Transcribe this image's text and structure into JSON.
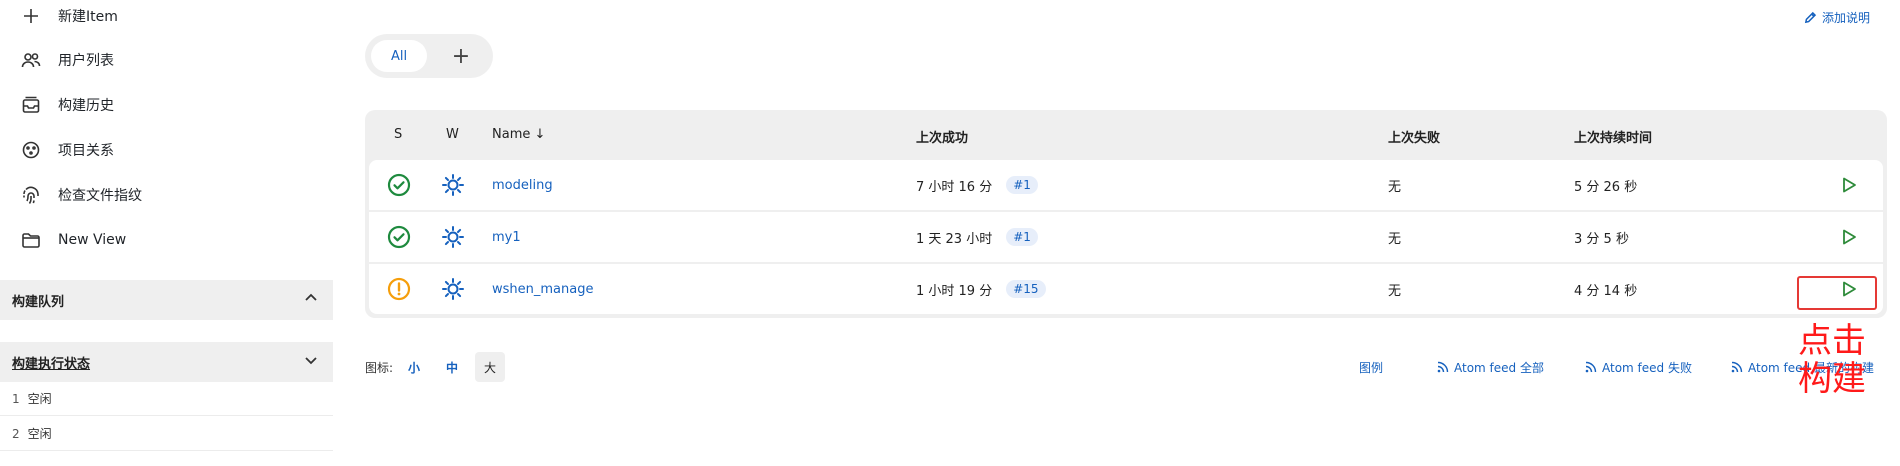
{
  "sidebar": {
    "items": [
      {
        "label": "新建Item",
        "icon": "plus-icon"
      },
      {
        "label": "用户列表",
        "icon": "users-icon"
      },
      {
        "label": "构建历史",
        "icon": "history-icon"
      },
      {
        "label": "项目关系",
        "icon": "relationship-icon"
      },
      {
        "label": "检查文件指纹",
        "icon": "fingerprint-icon"
      },
      {
        "label": "New View",
        "icon": "folder-icon"
      }
    ],
    "queue_panel": {
      "title": "构建队列"
    },
    "executor_panel": {
      "title": "构建执行状态",
      "executors": [
        {
          "number": "1",
          "status": "空闲"
        },
        {
          "number": "2",
          "status": "空闲"
        }
      ]
    }
  },
  "header": {
    "add_description": "添加说明"
  },
  "tabs": {
    "all_label": "All",
    "add_label": "+"
  },
  "table": {
    "headers": {
      "s": "S",
      "w": "W",
      "name": "Name ↓",
      "last_success": "上次成功",
      "last_failure": "上次失败",
      "last_duration": "上次持续时间"
    },
    "rows": [
      {
        "status": "success",
        "name": "modeling",
        "last_success": "7 小时 16 分",
        "success_build": "#1",
        "last_failure": "无",
        "duration": "5 分 26 秒"
      },
      {
        "status": "success",
        "name": "my1",
        "last_success": "1 天 23 小时",
        "success_build": "#1",
        "last_failure": "无",
        "duration": "3 分 5 秒"
      },
      {
        "status": "unstable",
        "name": "wshen_manage",
        "last_success": "1 小时 19 分",
        "success_build": "#15",
        "last_failure": "无",
        "duration": "4 分 14 秒"
      }
    ]
  },
  "footer": {
    "icon_label": "图标:",
    "sizes": [
      "小",
      "中",
      "大"
    ],
    "active_size": "大",
    "legend": "图例",
    "atom_all": "Atom feed 全部",
    "atom_fail": "Atom feed 失败",
    "atom_latest": "Atom feed 最新的构建"
  },
  "annotation": {
    "text": "点击构建"
  },
  "colors": {
    "accent": "#1661be",
    "success": "#1e8a3e",
    "unstable": "#f59e0b",
    "annotation": "#ff1a1a"
  }
}
